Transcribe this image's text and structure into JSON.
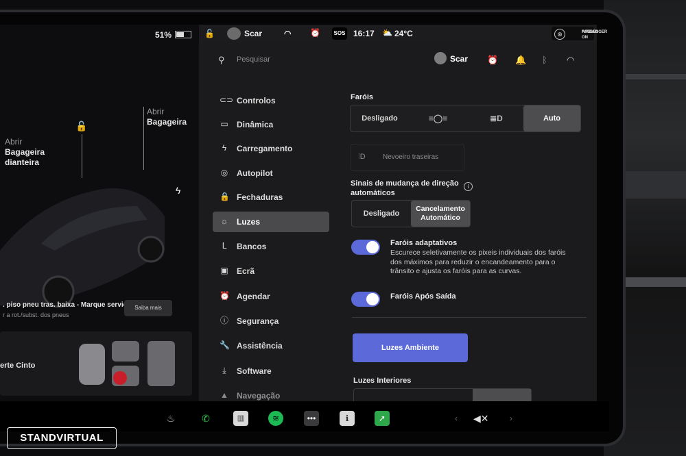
{
  "status": {
    "battery": "51%",
    "battery_level": 0.51,
    "profile": "Scar",
    "time": "16:17",
    "temperature": "24°C",
    "sos": "SOS",
    "airbag_line1": "PASSENGER",
    "airbag_line2": "AIRBAG ON"
  },
  "car_panel": {
    "rear_trunk_action": "Abrir",
    "rear_trunk_name": "Bagageira",
    "front_trunk_action": "Abrir",
    "front_trunk_name_1": "Bagageira",
    "front_trunk_name_2": "dianteira",
    "tire_warning": ". piso pneu tras. baixa - Marque serviço",
    "tire_sub": "r a rot./subst. dos pneus",
    "learn_more": "Saiba mais",
    "seatbelt": "erte Cinto"
  },
  "topbar": {
    "search_placeholder": "Pesquisar",
    "profile_name": "Scar"
  },
  "menu": {
    "items": [
      {
        "label": "Controlos",
        "icon": "toggle-icon"
      },
      {
        "label": "Dinâmica",
        "icon": "car-icon"
      },
      {
        "label": "Carregamento",
        "icon": "bolt-icon"
      },
      {
        "label": "Autopilot",
        "icon": "steering-wheel-icon"
      },
      {
        "label": "Fechaduras",
        "icon": "lock-icon"
      },
      {
        "label": "Luzes",
        "icon": "sun-icon"
      },
      {
        "label": "Bancos",
        "icon": "seat-icon"
      },
      {
        "label": "Ecrã",
        "icon": "display-icon"
      },
      {
        "label": "Agendar",
        "icon": "alarm-icon"
      },
      {
        "label": "Segurança",
        "icon": "info-icon"
      },
      {
        "label": "Assistência",
        "icon": "wrench-icon"
      },
      {
        "label": "Software",
        "icon": "download-icon"
      },
      {
        "label": "Navegação",
        "icon": "navigation-icon"
      }
    ],
    "active": "Luzes"
  },
  "lights": {
    "headlights_title": "Faróis",
    "headlights_options": [
      "Desligado",
      "",
      "",
      "Auto"
    ],
    "headlights_selected": "Auto",
    "fog_label": "Nevoeiro traseiras",
    "turn_signal_title_1": "Sinais de mudança de direção",
    "turn_signal_title_2": "automáticos",
    "turn_signal_options": [
      "Desligado",
      "Cancelamento Automático"
    ],
    "turn_signal_option_2_line1": "Cancelamento",
    "turn_signal_option_2_line2": "Automático",
    "turn_signal_selected": "Cancelamento Automático",
    "adaptive_title": "Faróis adaptativos",
    "adaptive_on": true,
    "adaptive_desc": "Escurece seletivamente os pixeis individuais dos faróis dos máximos para reduzir o encandeamento para o trânsito e ajusta os faróis para as curvas.",
    "after_exit_title": "Faróis Após Saída",
    "after_exit_on": true,
    "ambient_button": "Luzes Ambiente",
    "interior_title": "Luzes Interiores"
  },
  "watermark": "STANDVIRTUAL",
  "colors": {
    "accent": "#5b6ad8",
    "panel": "#1b1b1d",
    "selected": "#4d4d4f"
  }
}
